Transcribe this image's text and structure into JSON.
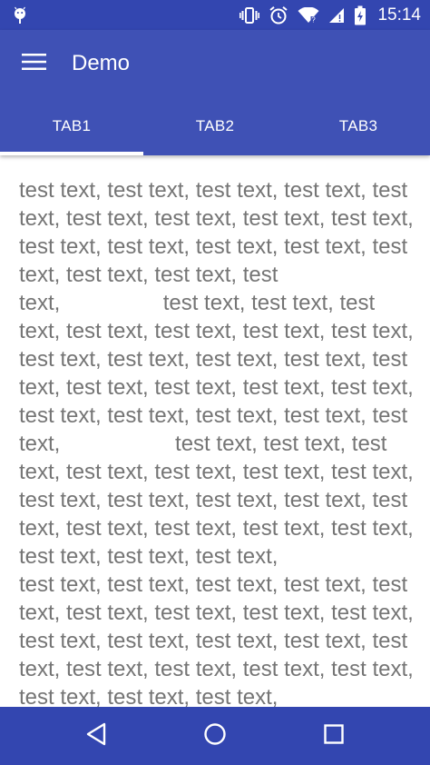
{
  "status_bar": {
    "time": "15:14",
    "icons": [
      "android-debug-icon",
      "vibrate-icon",
      "alarm-icon",
      "wifi-icon",
      "signal-icon",
      "battery-charging-icon"
    ]
  },
  "toolbar": {
    "title": "Demo",
    "menu_icon": "hamburger-menu-icon"
  },
  "tabs": [
    {
      "label": "TAB1",
      "selected": true
    },
    {
      "label": "TAB2",
      "selected": false
    },
    {
      "label": "TAB3",
      "selected": false
    }
  ],
  "content": {
    "text": "test text, test text, test text, test text, test text, test text, test text, test text, test text, test text, test text, test text, test text, test text, test text, test text, test text,                 test text, test text, test text, test text, test text, test text, test text, test text, test text, test text, test text, test text, test text, test text, test text, test text, test text, test text, test text, test text, test text,                   test text, test text, test text, test text, test text, test text, test text, test text, test text, test text, test text, test text, test text, test text, test text, test text, test text, test text, test text,                  test text, test text, test text, test text, test text, test text, test text, test text, test text, test text, test text, test text, test text, test text, test text, test text, test text, test text, test text, test text, test text,"
  },
  "nav_bar": {
    "buttons": [
      "back-icon",
      "home-icon",
      "recents-icon"
    ]
  },
  "colors": {
    "primary": "#3f51b5",
    "primary_dark": "#3346b0",
    "text_secondary": "#757575"
  }
}
